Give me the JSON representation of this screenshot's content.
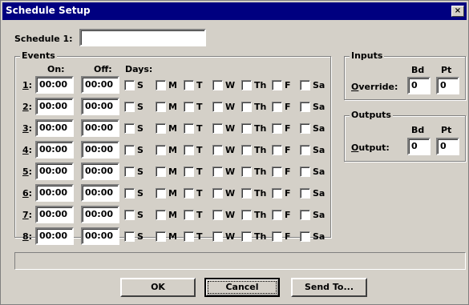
{
  "window": {
    "title": "Schedule Setup",
    "close_glyph": "×"
  },
  "schedule": {
    "label": "Schedule 1:",
    "value": ""
  },
  "events": {
    "legend": "Events",
    "on_header": "On:",
    "off_header": "Off:",
    "days_header": "Days:",
    "day_labels": [
      "S",
      "M",
      "T",
      "W",
      "Th",
      "F",
      "Sa"
    ],
    "rows": [
      {
        "num": "1",
        "on": "00:00",
        "off": "00:00"
      },
      {
        "num": "2",
        "on": "00:00",
        "off": "00:00"
      },
      {
        "num": "3",
        "on": "00:00",
        "off": "00:00"
      },
      {
        "num": "4",
        "on": "00:00",
        "off": "00:00"
      },
      {
        "num": "5",
        "on": "00:00",
        "off": "00:00"
      },
      {
        "num": "6",
        "on": "00:00",
        "off": "00:00"
      },
      {
        "num": "7",
        "on": "00:00",
        "off": "00:00"
      },
      {
        "num": "8",
        "on": "00:00",
        "off": "00:00"
      }
    ]
  },
  "inputs": {
    "legend": "Inputs",
    "bd_header": "Bd",
    "pt_header": "Pt",
    "label_underlined": "O",
    "label_rest": "verride:",
    "bd": "0",
    "pt": "0"
  },
  "outputs": {
    "legend": "Outputs",
    "bd_header": "Bd",
    "pt_header": "Pt",
    "label_underlined": "O",
    "label_rest": "utput:",
    "bd": "0",
    "pt": "0"
  },
  "status_text": "",
  "buttons": {
    "ok": "OK",
    "cancel": "Cancel",
    "send_to": "Send To..."
  }
}
